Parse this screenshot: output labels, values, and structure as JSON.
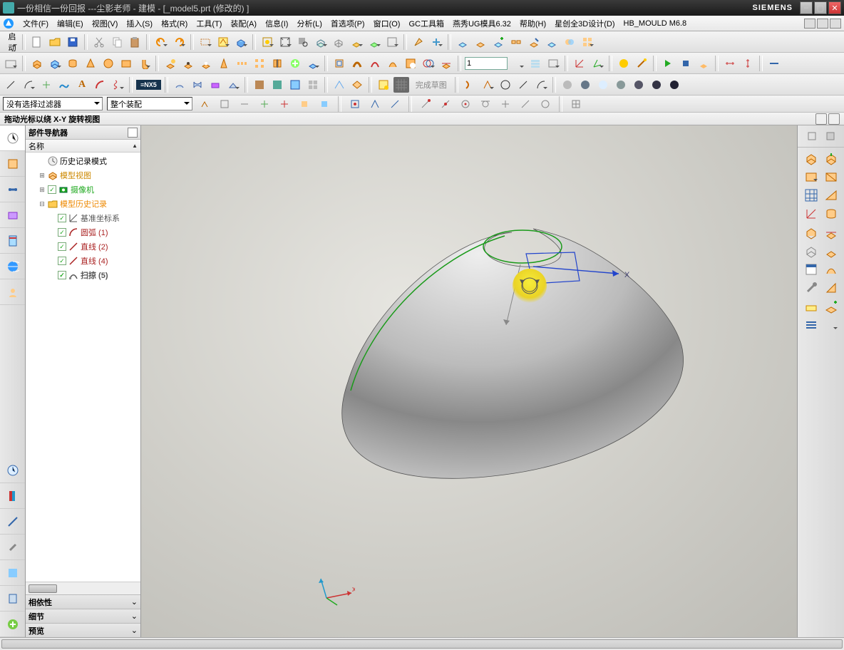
{
  "title": "一份相信一份回报    ---尘影老师 - 建模 - [_model5.prt  (修改的)  ]",
  "brand": "SIEMENS",
  "menus": [
    "文件(F)",
    "编辑(E)",
    "视图(V)",
    "插入(S)",
    "格式(R)",
    "工具(T)",
    "装配(A)",
    "信息(I)",
    "分析(L)",
    "首选项(P)",
    "窗口(O)",
    "GC工具箱",
    "燕秀UG模具6.32",
    "帮助(H)",
    "星创全3D设计(D)",
    "HB_MOULD M6.8"
  ],
  "start_label": "启动",
  "input_value": "1",
  "sketch_done": "完成草图",
  "filter": {
    "left": "没有选择过滤器",
    "right": "整个装配"
  },
  "hint": "拖动光标以绕 X-Y 旋转视图",
  "nav": {
    "title": "部件导航器",
    "col": "名称",
    "items": [
      {
        "indent": 1,
        "twist": "",
        "chk": false,
        "icon": "clock",
        "label": "历史记录模式",
        "color": "#888"
      },
      {
        "indent": 1,
        "twist": "⊞",
        "chk": false,
        "icon": "model",
        "label": "模型视图",
        "color": "#c80"
      },
      {
        "indent": 1,
        "twist": "⊞",
        "chk": true,
        "icon": "camera",
        "label": "摄像机",
        "color": "#2a2"
      },
      {
        "indent": 1,
        "twist": "⊟",
        "chk": false,
        "icon": "folder",
        "label": "模型历史记录",
        "color": "#e80"
      },
      {
        "indent": 2,
        "twist": "",
        "chk": true,
        "icon": "csys",
        "label": "基准坐标系",
        "color": "#555"
      },
      {
        "indent": 2,
        "twist": "",
        "chk": true,
        "icon": "arc",
        "label": "圆弧 (1)",
        "color": "#a22"
      },
      {
        "indent": 2,
        "twist": "",
        "chk": true,
        "icon": "line",
        "label": "直线 (2)",
        "color": "#a22"
      },
      {
        "indent": 2,
        "twist": "",
        "chk": true,
        "icon": "line",
        "label": "直线 (4)",
        "color": "#a22"
      },
      {
        "indent": 2,
        "twist": "",
        "chk": true,
        "icon": "sweep",
        "label": "扫掠 (5)",
        "color": "#555",
        "bold": true
      }
    ],
    "sections": [
      "相依性",
      "细节",
      "预览"
    ]
  },
  "axis_x": "X"
}
